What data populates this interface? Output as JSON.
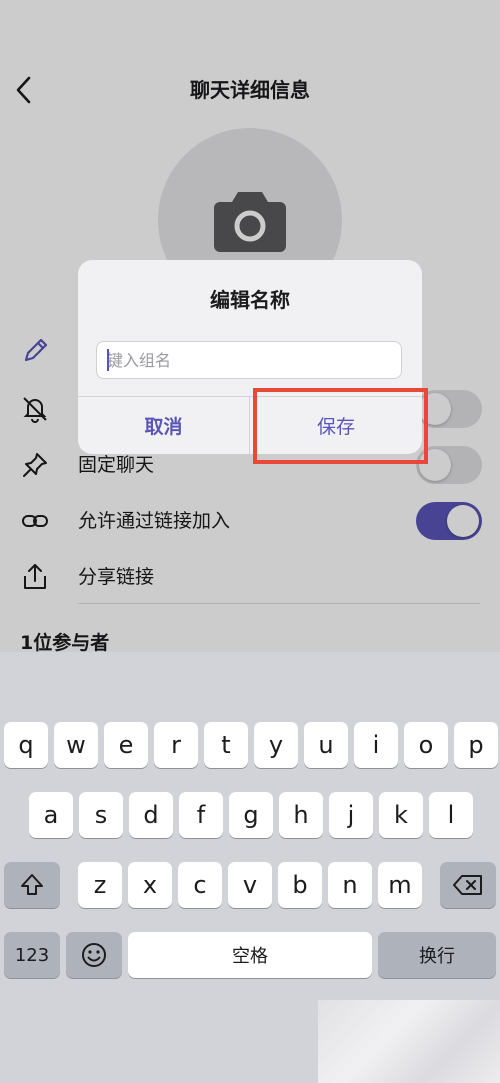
{
  "header": {
    "title": "聊天详细信息"
  },
  "settings": {
    "rows": [
      {
        "label": "",
        "icon": "bell-off-icon",
        "toggle": false
      },
      {
        "label": "固定聊天",
        "icon": "pin-icon",
        "toggle": false
      },
      {
        "label": "允许通过链接加入",
        "icon": "link-icon",
        "toggle": true
      },
      {
        "label": "分享链接",
        "icon": "share-icon"
      }
    ],
    "participants_title": "1位参与者"
  },
  "dialog": {
    "title": "编辑名称",
    "input_value": "",
    "input_placeholder": "键入组名",
    "cancel_label": "取消",
    "save_label": "保存"
  },
  "keyboard": {
    "row1": [
      "q",
      "w",
      "e",
      "r",
      "t",
      "y",
      "u",
      "i",
      "o",
      "p"
    ],
    "row2": [
      "a",
      "s",
      "d",
      "f",
      "g",
      "h",
      "j",
      "k",
      "l"
    ],
    "row3": [
      "z",
      "x",
      "c",
      "v",
      "b",
      "n",
      "m"
    ],
    "numbers_label": "123",
    "space_label": "空格",
    "return_label": "换行"
  },
  "colors": {
    "accent": "#5a55b8",
    "highlight": "#e8483a"
  }
}
